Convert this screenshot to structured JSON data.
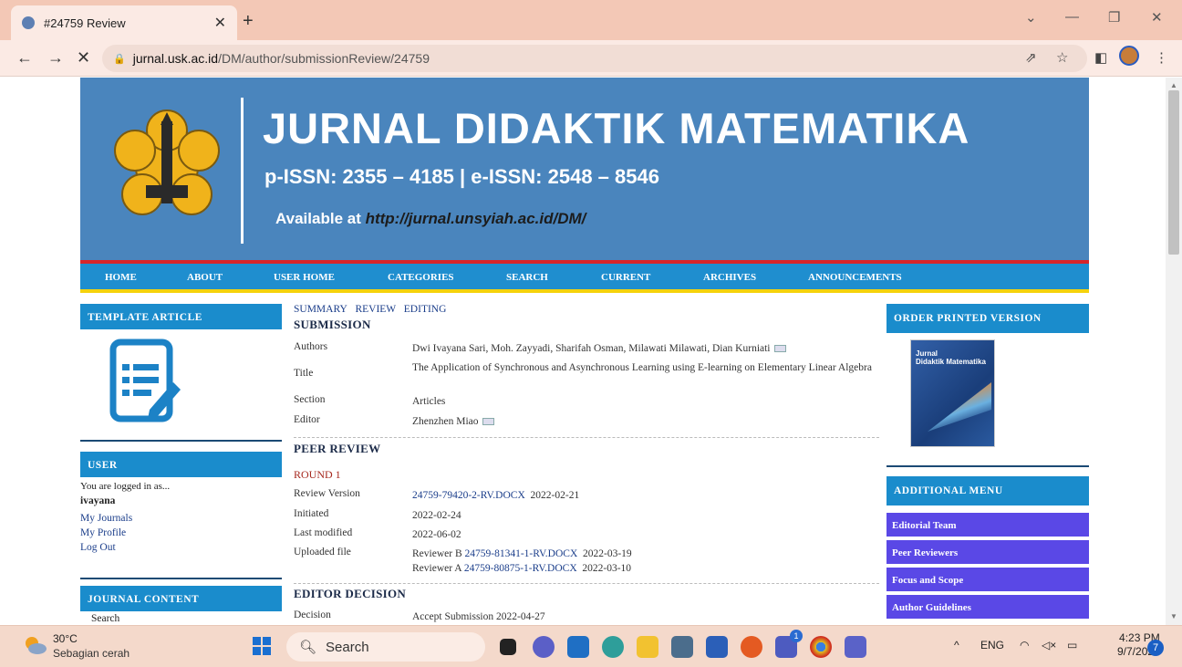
{
  "browser": {
    "tab_title": "#24759 Review",
    "url_host": "jurnal.usk.ac.id",
    "url_path": "/DM/author/submissionReview/24759"
  },
  "banner": {
    "title": "JURNAL DIDAKTIK MATEMATIKA",
    "issn": "p-ISSN: 2355 – 4185 | e-ISSN: 2548 – 8546",
    "available_prefix": "Available at ",
    "available_url": "http://jurnal.unsyiah.ac.id/DM/"
  },
  "nav": [
    "HOME",
    "ABOUT",
    "USER HOME",
    "CATEGORIES",
    "SEARCH",
    "CURRENT",
    "ARCHIVES",
    "ANNOUNCEMENTS"
  ],
  "left_sidebar": {
    "template_title": "TEMPLATE ARTICLE",
    "user_title": "USER",
    "logged_in_as": "You are logged in as...",
    "username": "ivayana",
    "links": [
      "My Journals",
      "My Profile",
      "Log Out"
    ],
    "journal_content_title": "JOURNAL CONTENT",
    "search_label": "Search"
  },
  "subnav": {
    "summary": "SUMMARY",
    "review": "REVIEW",
    "editing": "EDITING"
  },
  "submission": {
    "heading": "SUBMISSION",
    "authors_label": "Authors",
    "authors": "Dwi Ivayana Sari, Moh. Zayyadi, Sharifah Osman, Milawati Milawati, Dian Kurniati",
    "title_label": "Title",
    "title": "The Application of Synchronous and Asynchronous Learning using E-learning on Elementary Linear Algebra",
    "section_label": "Section",
    "section": "Articles",
    "editor_label": "Editor",
    "editor": "Zhenzhen Miao"
  },
  "peer_review": {
    "heading": "PEER REVIEW",
    "round": "ROUND 1",
    "review_version_label": "Review Version",
    "review_version_file": "24759-79420-2-RV.DOCX",
    "review_version_date": "2022-02-21",
    "initiated_label": "Initiated",
    "initiated": "2022-02-24",
    "modified_label": "Last modified",
    "modified": "2022-06-02",
    "uploaded_label": "Uploaded file",
    "reviewer_b": "Reviewer B",
    "reviewer_b_file": "24759-81341-1-RV.DOCX",
    "reviewer_b_date": "2022-03-19",
    "reviewer_a": "Reviewer A",
    "reviewer_a_file": "24759-80875-1-RV.DOCX",
    "reviewer_a_date": "2022-03-10"
  },
  "editor_decision": {
    "heading": "EDITOR DECISION",
    "decision_label": "Decision",
    "decision": "Accept Submission 2022-04-27"
  },
  "right_sidebar": {
    "order_title": "ORDER PRINTED VERSION",
    "cover_text": "Jurnal\nDidaktik Matematika",
    "additional_title": "ADDITIONAL MENU",
    "menu": [
      "Editorial Team",
      "Peer Reviewers",
      "Focus and Scope",
      "Author Guidelines"
    ]
  },
  "taskbar": {
    "temp": "30°C",
    "weather": "Sebagian cerah",
    "search_placeholder": "Search",
    "lang": "ENG",
    "time": "4:23 PM",
    "date": "9/7/2023",
    "notif_count": "7",
    "teams_badge": "1"
  }
}
